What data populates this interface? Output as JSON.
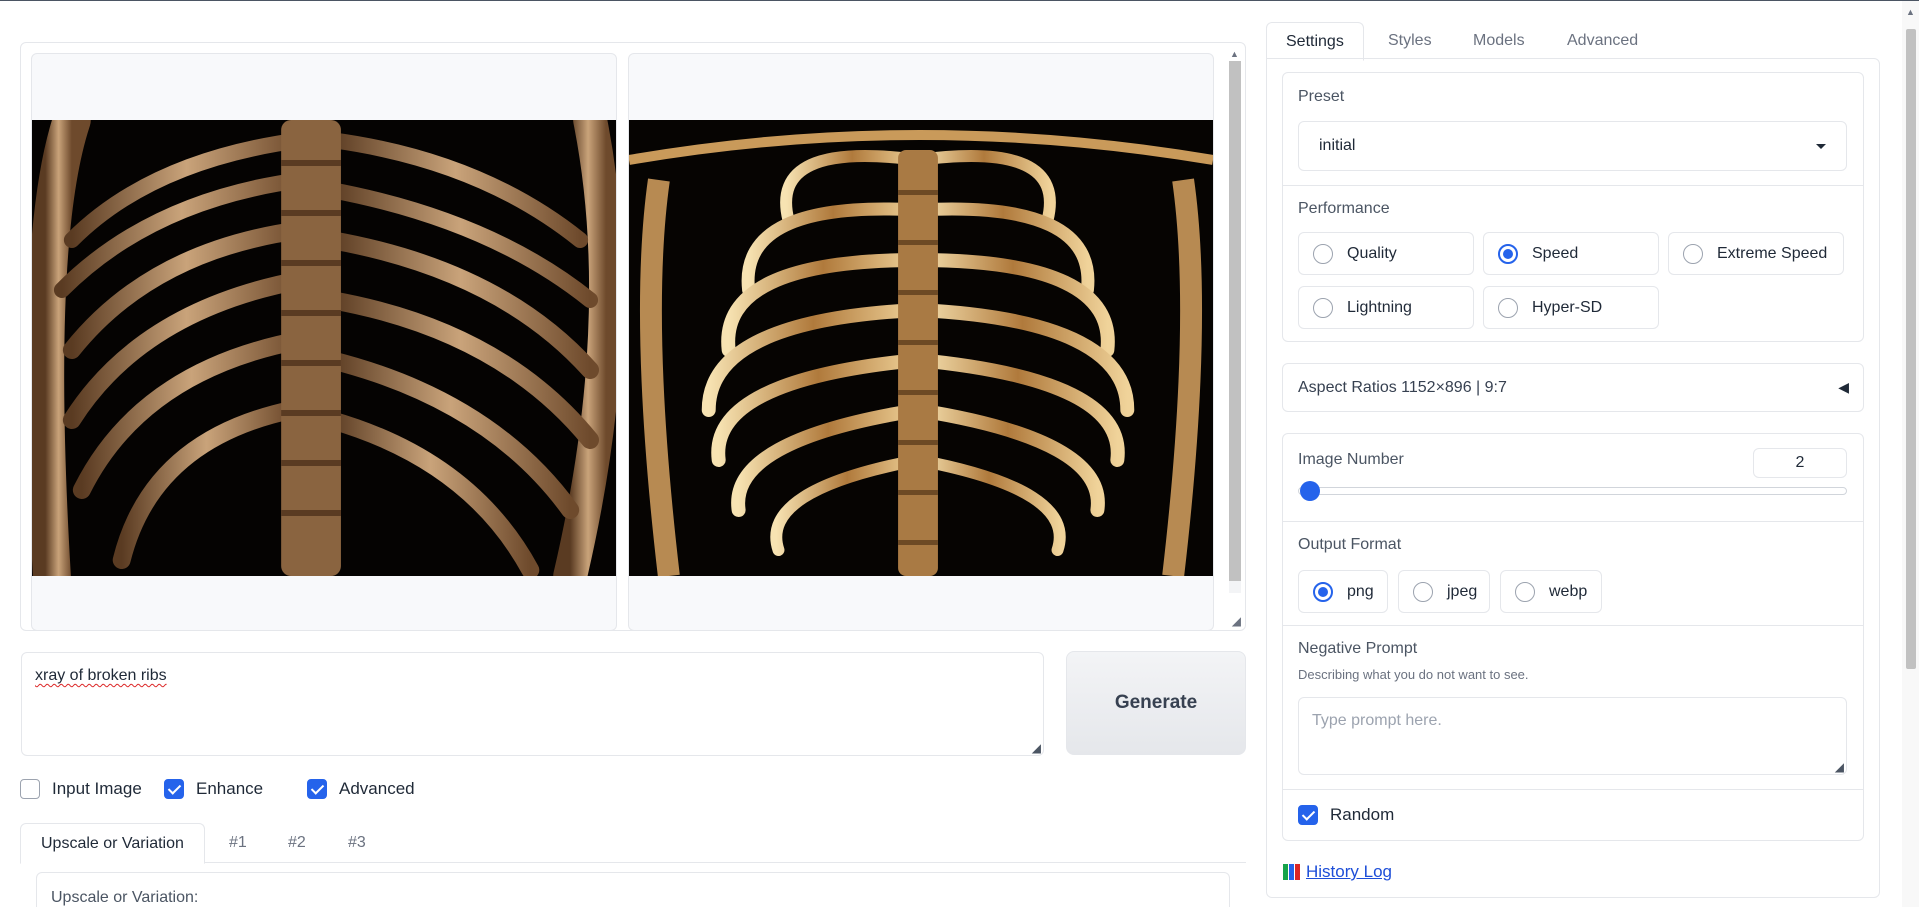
{
  "gallery": {
    "images": [
      {
        "alt": "ribcage image 1"
      },
      {
        "alt": "ribcage image 2"
      }
    ]
  },
  "prompt": {
    "value": "xray of broken ribs"
  },
  "generate_button": {
    "label": "Generate"
  },
  "options": {
    "input_image": {
      "label": "Input Image",
      "checked": false
    },
    "enhance": {
      "label": "Enhance",
      "checked": true
    },
    "advanced": {
      "label": "Advanced",
      "checked": true
    }
  },
  "bottom_tabs": [
    {
      "label": "Upscale or Variation",
      "active": true
    },
    {
      "label": "#1"
    },
    {
      "label": "#2"
    },
    {
      "label": "#3"
    }
  ],
  "upscale_box": {
    "label": "Upscale or Variation:"
  },
  "right_tabs": [
    {
      "label": "Settings",
      "active": true
    },
    {
      "label": "Styles"
    },
    {
      "label": "Models"
    },
    {
      "label": "Advanced"
    }
  ],
  "settings": {
    "preset": {
      "label": "Preset",
      "value": "initial"
    },
    "performance": {
      "label": "Performance",
      "options": [
        "Quality",
        "Speed",
        "Extreme Speed",
        "Lightning",
        "Hyper-SD"
      ],
      "selected": "Speed"
    },
    "aspect_ratios": {
      "label": "Aspect Ratios 1152×896 | 9:7"
    },
    "image_number": {
      "label": "Image Number",
      "value": "2",
      "level": 0.0
    },
    "output_format": {
      "label": "Output Format",
      "options": [
        "png",
        "jpeg",
        "webp"
      ],
      "selected": "png"
    },
    "negative_prompt": {
      "label": "Negative Prompt",
      "description": "Describing what you do not want to see.",
      "placeholder": "Type prompt here."
    },
    "random": {
      "label": "Random",
      "checked": true
    },
    "history_log": {
      "label": "History Log"
    }
  },
  "colors": {
    "accent": "#2563eb",
    "border": "#e5e7eb",
    "link": "#1d4ed8"
  }
}
